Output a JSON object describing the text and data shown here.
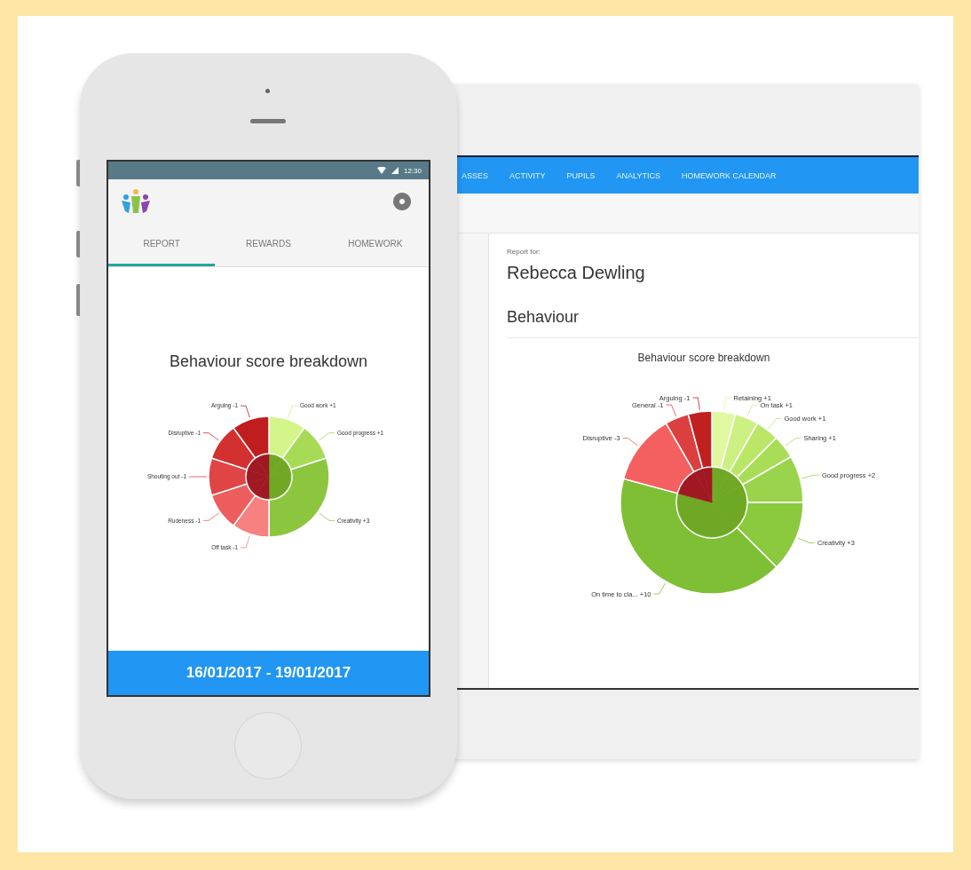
{
  "phone": {
    "status_bar": {
      "time": "12:30"
    },
    "tabs": [
      {
        "label": "REPORT",
        "selected": true
      },
      {
        "label": "REWARDS",
        "selected": false
      },
      {
        "label": "HOMEWORK",
        "selected": false
      }
    ],
    "chart_data": {
      "type": "donut",
      "title": "Behaviour score breakdown",
      "categories": [
        "Good work +1",
        "Good progress +1",
        "Creativity +3",
        "Off task -1",
        "Rudeness -1",
        "Shouting out -1",
        "Disruptive -1",
        "Arguing -1"
      ],
      "series": [
        {
          "colors": [
            "#d4f58a",
            "#a8db55",
            "#8cc63f",
            "#f78080",
            "#ee5d5d",
            "#e04545",
            "#d33030",
            "#c01e1e"
          ],
          "values": [
            1,
            1,
            3,
            1,
            1,
            1,
            1,
            1
          ]
        }
      ]
    },
    "date_range": "16/01/2017 - 19/01/2017"
  },
  "browser": {
    "nav": [
      "ASSES",
      "ACTIVITY",
      "PUPILS",
      "ANALYTICS",
      "HOMEWORK CALENDAR"
    ],
    "report_for_label": "Report for:",
    "pupil_name": "Rebecca Dewling",
    "section_title": "Behaviour",
    "chart_data": {
      "type": "donut",
      "title": "Behaviour score breakdown",
      "categories": [
        "Retaining +1",
        "On task +1",
        "Good work +1",
        "Sharing +1",
        "Good progress +2",
        "Creativity +3",
        "On time to cla... +10",
        "Disruptive -3",
        "General -1",
        "Arguing -1"
      ],
      "series": [
        {
          "colors": [
            "#e0f8a0",
            "#cdf082",
            "#bbe768",
            "#a9dd58",
            "#9ad44c",
            "#8bc93f",
            "#7fbf35",
            "#f46060",
            "#dc3f3f",
            "#c02020"
          ],
          "values": [
            1,
            1,
            1,
            1,
            2,
            3,
            10,
            3,
            1,
            1
          ]
        }
      ]
    }
  }
}
